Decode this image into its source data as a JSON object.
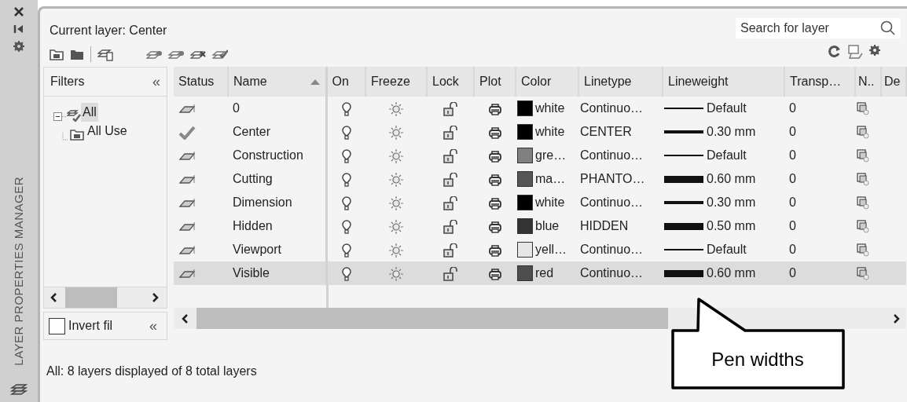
{
  "side_strip": {
    "title": "LAYER PROPERTIES MANAGER"
  },
  "header": {
    "current_layer": "Current layer: Center"
  },
  "search": {
    "placeholder": "Search for layer"
  },
  "filters": {
    "title": "Filters",
    "collapse": "«",
    "tree": [
      {
        "label": "All",
        "expanded": true,
        "selected": true,
        "children": [
          {
            "label": "All Use",
            "selected": false
          }
        ]
      }
    ],
    "invert": {
      "label": "Invert fil",
      "checked": false,
      "collapse": "«"
    }
  },
  "table": {
    "columns": [
      {
        "label": "Status",
        "sorted": false
      },
      {
        "label": "Name",
        "sorted": true
      },
      {
        "label": "On",
        "sorted": false
      },
      {
        "label": "Freeze",
        "sorted": false
      },
      {
        "label": "Lock",
        "sorted": false
      },
      {
        "label": "Plot",
        "sorted": false
      },
      {
        "label": "Color",
        "sorted": false
      },
      {
        "label": "Linetype",
        "sorted": false
      },
      {
        "label": "Lineweight",
        "sorted": false
      },
      {
        "label": "Transp…",
        "sorted": false
      },
      {
        "label": "N..",
        "sorted": false
      },
      {
        "label": "De",
        "sorted": false
      }
    ],
    "rows": [
      {
        "current": false,
        "name": "0",
        "on": true,
        "frozen": false,
        "locked": false,
        "plot": true,
        "color": "#000000",
        "color_name": "white",
        "linetype": "Continuo…",
        "kind": "default",
        "lineweight": "Default",
        "transparency": "0",
        "selected": false
      },
      {
        "current": true,
        "name": "Center",
        "on": true,
        "frozen": false,
        "locked": false,
        "plot": true,
        "color": "#000000",
        "color_name": "white",
        "linetype": "CENTER",
        "kind": "medium",
        "lineweight": "0.30 mm",
        "transparency": "0",
        "selected": false
      },
      {
        "current": false,
        "name": "Construction",
        "on": true,
        "frozen": false,
        "locked": false,
        "plot": true,
        "color": "#808080",
        "color_name": "gre…",
        "linetype": "Continuo…",
        "kind": "default",
        "lineweight": "Default",
        "transparency": "0",
        "selected": false
      },
      {
        "current": false,
        "name": "Cutting",
        "on": true,
        "frozen": false,
        "locked": false,
        "plot": true,
        "color": "#555555",
        "color_name": "ma…",
        "linetype": "PHANTO…",
        "kind": "heavy",
        "lineweight": "0.60 mm",
        "transparency": "0",
        "selected": false
      },
      {
        "current": false,
        "name": "Dimension",
        "on": true,
        "frozen": false,
        "locked": false,
        "plot": true,
        "color": "#000000",
        "color_name": "white",
        "linetype": "Continuo…",
        "kind": "medium",
        "lineweight": "0.30 mm",
        "transparency": "0",
        "selected": false
      },
      {
        "current": false,
        "name": "Hidden",
        "on": true,
        "frozen": false,
        "locked": false,
        "plot": true,
        "color": "#333333",
        "color_name": "blue",
        "linetype": "HIDDEN",
        "kind": "heavy",
        "lineweight": "0.50 mm",
        "transparency": "0",
        "selected": false
      },
      {
        "current": false,
        "name": "Viewport",
        "on": true,
        "frozen": false,
        "locked": false,
        "plot": true,
        "color": "#e6e6e6",
        "color_name": "yell…",
        "linetype": "Continuo…",
        "kind": "default",
        "lineweight": "Default",
        "transparency": "0",
        "selected": false
      },
      {
        "current": false,
        "name": "Visible",
        "on": true,
        "frozen": false,
        "locked": false,
        "plot": true,
        "color": "#4d4d4d",
        "color_name": "red",
        "linetype": "Continuo…",
        "kind": "heavy",
        "lineweight": "0.60 mm",
        "transparency": "0",
        "selected": true
      }
    ]
  },
  "callout": {
    "text": "Pen widths"
  },
  "status_bar": "All: 8 layers displayed of 8 total layers"
}
